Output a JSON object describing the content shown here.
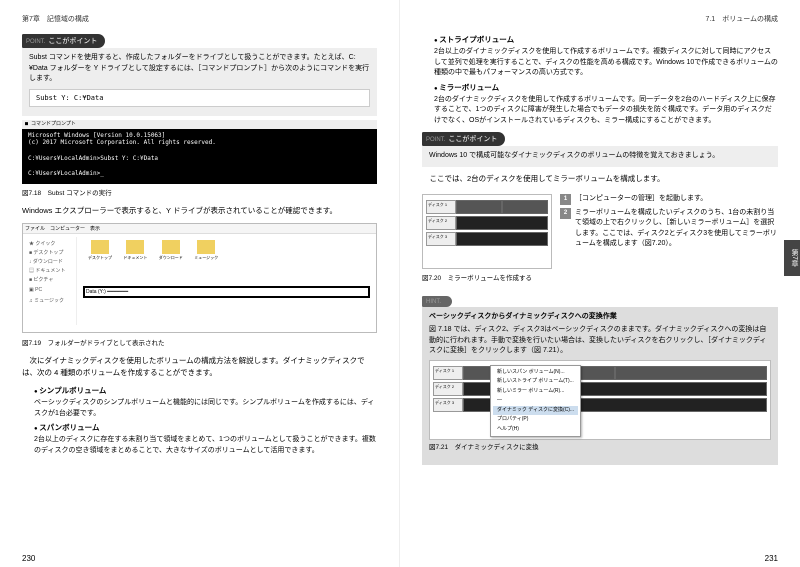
{
  "header": {
    "left": "第7章　記憶域の構成",
    "right": "7.1　ボリュームの構成"
  },
  "point1": {
    "tab_prefix": "POINT.",
    "tab_label": "ここがポイント",
    "body": "Subst コマンドを使用すると、作成したフォルダーをドライブとして扱うことができます。たとえば、C:¥Data フォルダーを Y ドライブとして設定するには、［コマンドプロンプト］から次のようにコマンドを実行します。"
  },
  "cmd": "Subst Y: C:¥Data",
  "terminal": {
    "bar": "■ コマンドプロンプト",
    "l1": "Microsoft Windows [Version 10.0.15063]",
    "l2": "(c) 2017 Microsoft Corporation. All rights reserved.",
    "l3": "C:¥Users¥LocalAdmin>Subst Y: C:¥Data",
    "l4": "C:¥Users¥LocalAdmin>_"
  },
  "cap718": "図7.18　Subst コマンドの実行",
  "txt1": "Windows エクスプローラーで表示すると、Y ドライブが表示されていることが確認できます。",
  "explorer": {
    "bar": "ファイル　コンピューター　表示",
    "side": [
      "★ クイック",
      "■ デスクトップ",
      "↓ ダウンロード",
      "▤ ドキュメント",
      "■ ピクチャ",
      "",
      "▣ PC",
      "",
      "♫ ミュージック"
    ],
    "folders": [
      "デスクトップ",
      "ドキュメント",
      "ダウンロード",
      "ミュージック"
    ],
    "drive_y": "Data (Y:)"
  },
  "cap719": "図7.19　フォルダーがドライブとして表示された",
  "txt2": "　次にダイナミックディスクを使用したボリュームの構成方法を解説します。ダイナミックディスクでは、次の 4 種類のボリュームを作成することができます。",
  "bullets_left": [
    {
      "t": "シンプルボリューム",
      "d": "ベーシックディスクのシンプルボリュームと機能的には同じです。シンプルボリュームを作成するには、ディスクが1台必要です。"
    },
    {
      "t": "スパンボリューム",
      "d": "2台以上のディスクに存在する未割り当て領域をまとめて、1つのボリュームとして扱うことができます。複数のディスクの空き領域をまとめることで、大きなサイズのボリュームとして活用できます。"
    }
  ],
  "bullets_right": [
    {
      "t": "ストライプボリューム",
      "d": "2台以上のダイナミックディスクを使用して作成するボリュームです。複数ディスクに対して同時にアクセスして並列で処理を実行することで、ディスクの性能を高める構成です。Windows 10で作成できるボリュームの種類の中で最もパフォーマンスの高い方式です。"
    },
    {
      "t": "ミラーボリューム",
      "d": "2台のダイナミックディスクを使用して作成するボリュームです。同一データを2台のハードディスク上に保存することで、1つのディスクに障害が発生した場合でもデータの損失を防ぐ構成です。データ用のディスクだけでなく、OSがインストールされているディスクも、ミラー構成にすることができます。"
    }
  ],
  "point2": {
    "tab_prefix": "POINT.",
    "tab_label": "ここがポイント",
    "body": "Windows 10 で構成可能なダイナミックディスクのボリュームの特徴を覚えておきましょう。"
  },
  "txt3": "　ここでは、2台のディスクを使用してミラーボリュームを構成します。",
  "steps": [
    {
      "n": "1",
      "t": "［コンピューターの管理］を起動します。"
    },
    {
      "n": "2",
      "t": "ミラーボリュームを構成したいディスクのうち、1台の未割り当て領域の上で右クリックし、［新しいミラーボリューム］を選択します。ここでは、ディスク2とディスク3を使用してミラーボリュームを構成します（図7.20）。"
    }
  ],
  "disk720": {
    "labels": [
      "ディスク 1",
      "ディスク 2",
      "ディスク 3"
    ]
  },
  "cap720": "図7.20　ミラーボリュームを作成する",
  "hint": {
    "tab_prefix": "HINT.",
    "title": "ベーシックディスクからダイナミックディスクへの変換作業",
    "body": "図 7.18 では、ディスク2、ディスク3はベーシックディスクのままです。ダイナミックディスクへの変換は自動的に行われます。手動で変換を行いたい場合は、変換したいディスクを右クリックし、［ダイナミックディスクに変換］をクリックします（図 7.21）。"
  },
  "ctx": [
    "新しいスパン ボリューム(N)...",
    "新しいストライプ ボリューム(T)...",
    "新しいミラー ボリューム(R)...",
    "―",
    "ダイナミック ディスクに変換(C)...",
    "プロパティ(P)",
    "ヘルプ(H)"
  ],
  "cap721": "図7.21　ダイナミックディスクに変換",
  "chapter_tab": "第7章",
  "pages": {
    "l": "230",
    "r": "231"
  }
}
